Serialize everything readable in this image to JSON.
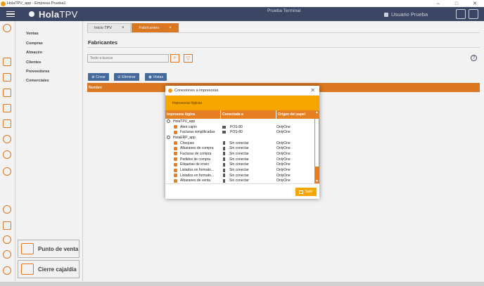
{
  "window": {
    "title": "HolaTPV_app - Empresa Prueba1",
    "min": "–",
    "max": "□",
    "close": "✕"
  },
  "header": {
    "logo_bold": "Hola",
    "logo_light": "TPV",
    "terminal": "Prueba Terminal",
    "user": "Usuario Prueba"
  },
  "menu": {
    "items": [
      "Ventas",
      "Compras",
      "Almacén",
      "Clientes",
      "Proveedores",
      "Comerciales"
    ],
    "punto_venta": "Punto de venta",
    "cierre_caja": "Cierre caja/día"
  },
  "tabs": [
    {
      "label": "Inicio TPV",
      "close": "×"
    },
    {
      "label": "Fabricantes",
      "close": "×"
    }
  ],
  "page": {
    "title": "Fabricantes",
    "search_placeholder": "Texto a buscar",
    "search_icon": "⌕",
    "filter_icon": "▽",
    "help_icon": "?",
    "buttons": {
      "create": "⊕ Crear",
      "delete": "⊝ Eliminar",
      "view": "◉ Vistas"
    },
    "grid_header": "Nombre"
  },
  "dialog": {
    "title": "Conexiones a impresoras",
    "close": "✕",
    "band_label": "Impresoras lógicas",
    "columns": [
      "Impresora lógica",
      "Conectada a",
      "Origen del papel"
    ],
    "scroll_up": "▲",
    "scroll_down": "▼",
    "groups": [
      {
        "name": "HolaTPV_app",
        "toggle": "⊖",
        "rows": [
          {
            "printer": "Abrir cajón",
            "connected": "POS-80",
            "source": "OnlyOne",
            "type": "pos"
          },
          {
            "printer": "Facturas simplificadas",
            "connected": "POS-80",
            "source": "OnlyOne",
            "type": "pos"
          }
        ]
      },
      {
        "name": "HolaERP_app",
        "toggle": "⊖",
        "rows": [
          {
            "printer": "Cheques",
            "connected": "Sin conectar",
            "source": "OnlyOne",
            "type": "none"
          },
          {
            "printer": "Albaranes de compra",
            "connected": "Sin conectar",
            "source": "OnlyOne",
            "type": "none"
          },
          {
            "printer": "Facturas de compra",
            "connected": "Sin conectar",
            "source": "OnlyOne",
            "type": "none"
          },
          {
            "printer": "Pedidos de compra",
            "connected": "Sin conectar",
            "source": "OnlyOne",
            "type": "none"
          },
          {
            "printer": "Etiquetas de envio",
            "connected": "Sin conectar",
            "source": "OnlyOne",
            "type": "none"
          },
          {
            "printer": "Listados en formato...",
            "connected": "Sin conectar",
            "source": "OnlyOne",
            "type": "none"
          },
          {
            "printer": "Listados en formato...",
            "connected": "Sin conectar",
            "source": "OnlyOne",
            "type": "none"
          },
          {
            "printer": "Albaranes de venta",
            "connected": "Sin conectar",
            "source": "OnlyOne",
            "type": "none"
          }
        ]
      }
    ],
    "exit_label": "Salir"
  }
}
